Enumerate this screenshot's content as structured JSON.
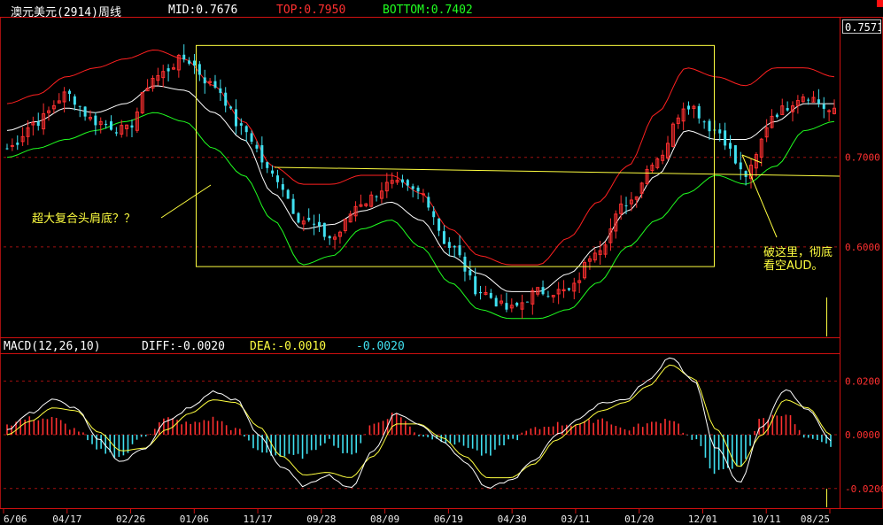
{
  "header": {
    "title": "澳元美元(2914)周线",
    "mid": "MID:0.7676",
    "top": "TOP:0.7950",
    "bottom": "BOTTOM:0.7402"
  },
  "macd_header": {
    "name": "MACD(12,26,10)",
    "diff": "DIFF:-0.0020",
    "dea": "DEA:-0.0010",
    "macd": "-0.0020"
  },
  "annotations": {
    "head_shoulders": "超大复合头肩底？？",
    "break_line1": "破这里，彻底",
    "break_line2": "看空AUD。"
  },
  "last_price": "0.7571",
  "colors": {
    "up": "#ff3030",
    "down": "#40e0f0",
    "mid_line": "#ffffff",
    "top_line": "#ff2020",
    "bottom_line": "#20ff20",
    "diff_line": "#ffffff",
    "dea_line": "#ffff40",
    "annotation": "#ffff40",
    "grid": "#a01010"
  },
  "chart_data": [
    {
      "type": "candlestick",
      "title": "澳元美元(2914)周线",
      "yticks": [
        "0.7000",
        "0.6000"
      ],
      "ylim": [
        0.5,
        0.855
      ],
      "xticks": [
        "6/06",
        "04/17",
        "02/26",
        "01/06",
        "11/17",
        "09/28",
        "08/09",
        "06/19",
        "04/30",
        "03/11",
        "01/20",
        "12/01",
        "10/11",
        "08/25"
      ],
      "close_trace": [
        0.71,
        0.74,
        0.77,
        0.74,
        0.73,
        0.79,
        0.81,
        0.78,
        0.73,
        0.68,
        0.63,
        0.61,
        0.65,
        0.67,
        0.66,
        0.6,
        0.55,
        0.53,
        0.55,
        0.55,
        0.6,
        0.65,
        0.7,
        0.76,
        0.73,
        0.68,
        0.75,
        0.77,
        0.75
      ],
      "mid_trace": [
        0.73,
        0.74,
        0.755,
        0.75,
        0.76,
        0.78,
        0.775,
        0.75,
        0.72,
        0.66,
        0.62,
        0.625,
        0.64,
        0.65,
        0.63,
        0.59,
        0.57,
        0.55,
        0.55,
        0.57,
        0.6,
        0.64,
        0.68,
        0.73,
        0.72,
        0.72,
        0.74,
        0.76,
        0.76
      ],
      "top_trace": [
        0.76,
        0.77,
        0.79,
        0.8,
        0.81,
        0.82,
        0.81,
        0.78,
        0.74,
        0.69,
        0.67,
        0.67,
        0.68,
        0.68,
        0.66,
        0.62,
        0.59,
        0.58,
        0.58,
        0.61,
        0.65,
        0.69,
        0.75,
        0.8,
        0.79,
        0.78,
        0.8,
        0.8,
        0.79
      ],
      "bottom_trace": [
        0.7,
        0.71,
        0.72,
        0.73,
        0.74,
        0.75,
        0.74,
        0.71,
        0.68,
        0.63,
        0.58,
        0.59,
        0.62,
        0.63,
        0.6,
        0.56,
        0.53,
        0.52,
        0.52,
        0.53,
        0.56,
        0.6,
        0.63,
        0.66,
        0.68,
        0.67,
        0.69,
        0.73,
        0.74
      ],
      "neckline_price": 0.683,
      "box_price_range": [
        0.578,
        0.825
      ]
    },
    {
      "type": "macd",
      "title": "MACD(12,26,10)",
      "yticks": [
        "0.0200",
        "0.0000",
        "-0.0200"
      ],
      "ylim": [
        -0.027,
        0.03
      ],
      "diff_trace": [
        0.002,
        0.008,
        0.013,
        0.01,
        -0.002,
        -0.01,
        -0.005,
        0.005,
        0.01,
        0.016,
        0.013,
        0.0,
        -0.012,
        -0.019,
        -0.015,
        -0.02,
        -0.006,
        0.008,
        0.004,
        -0.002,
        -0.01,
        -0.02,
        -0.017,
        -0.01,
        0.0,
        0.006,
        0.012,
        0.013,
        0.02,
        0.029,
        0.02,
        -0.005,
        -0.018,
        0.003,
        0.017,
        0.009,
        -0.002
      ],
      "dea_trace": [
        0.0,
        0.005,
        0.01,
        0.009,
        0.001,
        -0.006,
        -0.005,
        0.002,
        0.008,
        0.013,
        0.012,
        0.003,
        -0.008,
        -0.015,
        -0.014,
        -0.016,
        -0.008,
        0.004,
        0.004,
        -0.001,
        -0.008,
        -0.016,
        -0.016,
        -0.011,
        -0.002,
        0.004,
        0.009,
        0.012,
        0.018,
        0.026,
        0.021,
        0.002,
        -0.012,
        0.0,
        0.013,
        0.01,
        0.0
      ]
    }
  ]
}
